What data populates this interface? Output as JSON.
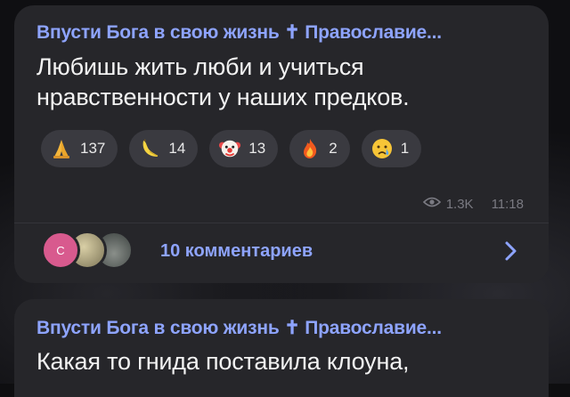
{
  "messages": [
    {
      "channel": "Впусти Бога в свою жизнь ✝ Православие...",
      "text_line1": "Любишь жить люби и учиться",
      "text_line2": "нравственности у наших предков.",
      "reactions": [
        {
          "icon": "praying-hands-icon",
          "count": "137"
        },
        {
          "icon": "banana-icon",
          "count": "14"
        },
        {
          "icon": "clown-face-icon",
          "count": "13"
        },
        {
          "icon": "fire-icon",
          "count": "2"
        },
        {
          "icon": "crying-face-icon",
          "count": "1"
        }
      ],
      "views": "1.3K",
      "time": "11:18",
      "avatar_letter": "C",
      "comments_label": "10 комментариев"
    },
    {
      "channel": "Впусти Бога в свою жизнь ✝ Православие...",
      "text_line1": "Какая то гнида поставила клоуна,"
    }
  ],
  "colors": {
    "accent": "#8ea4ff",
    "bubble": "#26262a",
    "reaction_bg": "#3a3a40"
  }
}
